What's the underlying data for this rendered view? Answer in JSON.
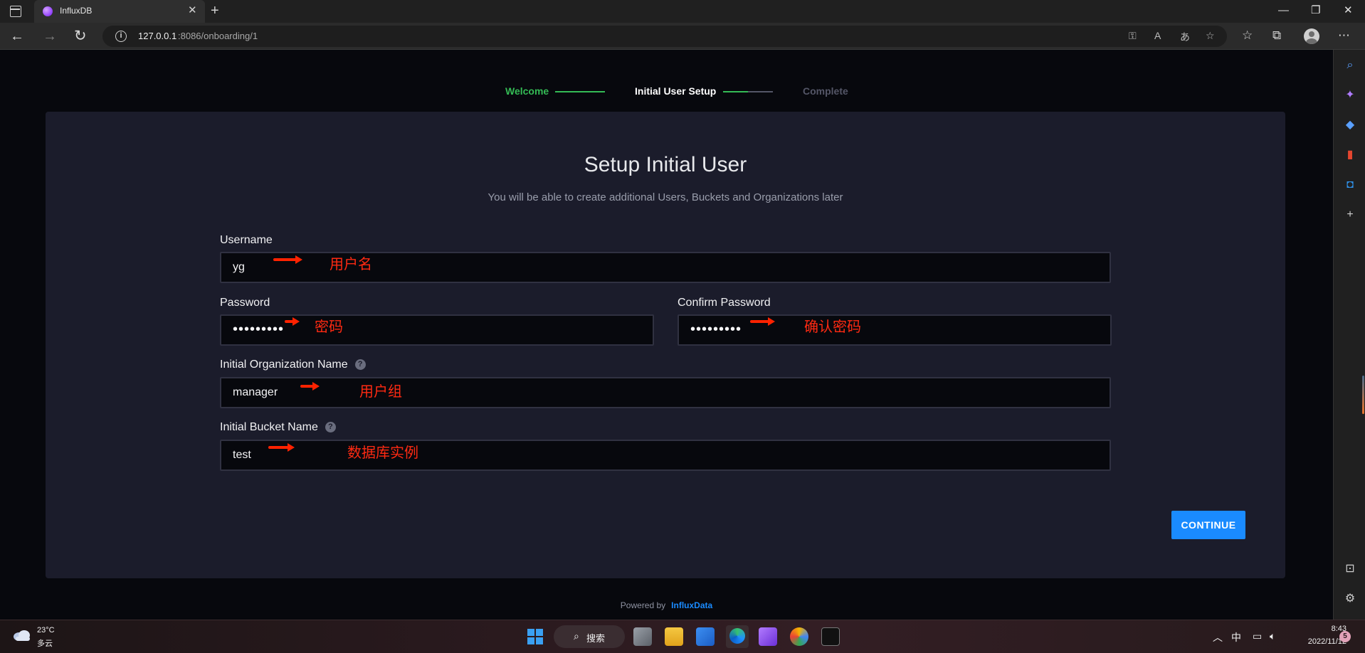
{
  "browser": {
    "tab_title": "InfluxDB",
    "url_host": "127.0.0.1",
    "url_path": ":8086/onboarding/1"
  },
  "stepper": {
    "welcome": "Welcome",
    "setup": "Initial User Setup",
    "complete": "Complete",
    "setup_progress": 0.5
  },
  "form": {
    "title": "Setup Initial User",
    "subtitle": "You will be able to create additional Users, Buckets and Organizations later",
    "username": {
      "label": "Username",
      "value": "yg",
      "note": "用户名"
    },
    "password": {
      "label": "Password",
      "value": "•••••••••",
      "note": "密码"
    },
    "confirm_password": {
      "label": "Confirm Password",
      "value": "•••••••••",
      "note": "确认密码"
    },
    "org_name": {
      "label": "Initial Organization Name",
      "value": "manager",
      "note": "用户组"
    },
    "bucket_name": {
      "label": "Initial Bucket Name",
      "value": "test",
      "note": "数据库实例"
    },
    "help_glyph": "?",
    "continue_label": "CONTINUE"
  },
  "footer": {
    "powered_by": "Powered by",
    "brand": "InfluxData"
  },
  "taskbar": {
    "weather_temp": "23°C",
    "weather_desc": "多云",
    "search_label": "搜索",
    "ime": "中",
    "time": "8:43",
    "date": "2022/11/12",
    "notifications": "5"
  },
  "colors": {
    "accent": "#1a8bff",
    "success": "#34bb55",
    "panel": "#1b1c2b",
    "annotation": "#ff2200"
  }
}
